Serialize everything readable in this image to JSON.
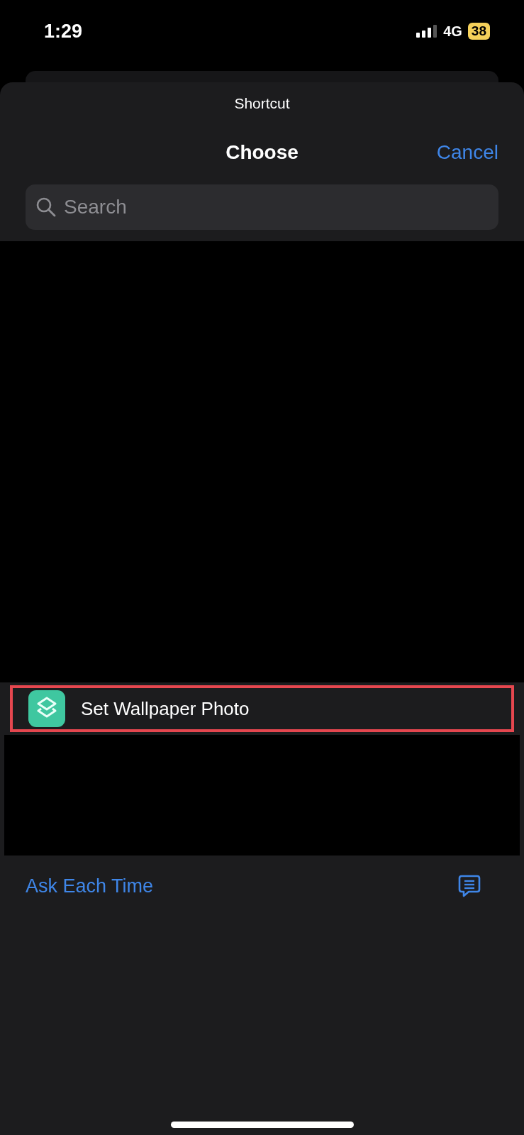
{
  "status_bar": {
    "time": "1:29",
    "network": "4G",
    "battery": "38"
  },
  "sheet": {
    "subtitle": "Shortcut",
    "title": "Choose",
    "cancel": "Cancel"
  },
  "search": {
    "placeholder": "Search"
  },
  "shortcuts": [
    {
      "name": "Set Wallpaper Photo",
      "highlighted": true
    }
  ],
  "ask_each_time": "Ask Each Time"
}
